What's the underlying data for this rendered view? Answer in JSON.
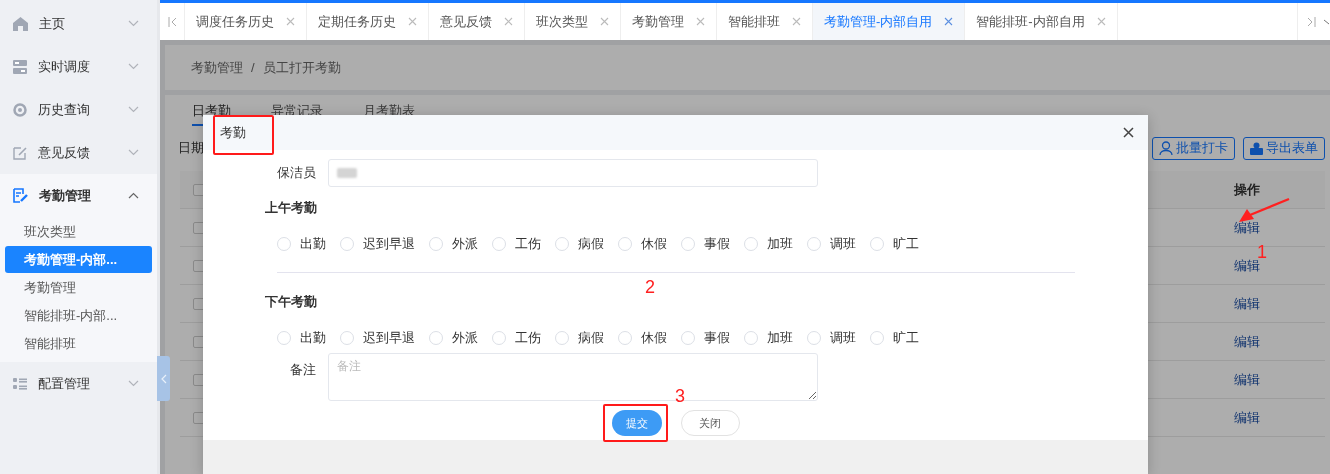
{
  "sidebar": {
    "items": [
      {
        "label": "主页",
        "kind": "home",
        "expanded": false
      },
      {
        "label": "实时调度",
        "kind": "grid",
        "expanded": false
      },
      {
        "label": "历史查询",
        "kind": "history",
        "expanded": false
      },
      {
        "label": "意见反馈",
        "kind": "edit",
        "expanded": false
      },
      {
        "label": "考勤管理",
        "kind": "attendance",
        "expanded": true,
        "children": [
          {
            "label": "班次类型",
            "selected": false
          },
          {
            "label": "考勤管理-内部...",
            "selected": true
          },
          {
            "label": "考勤管理",
            "selected": false
          },
          {
            "label": "智能排班-内部...",
            "selected": false
          },
          {
            "label": "智能排班",
            "selected": false
          }
        ]
      },
      {
        "label": "配置管理",
        "kind": "config",
        "expanded": false
      }
    ]
  },
  "tabs": [
    {
      "label": "调度任务历史",
      "selected": false
    },
    {
      "label": "定期任务历史",
      "selected": false
    },
    {
      "label": "意见反馈",
      "selected": false
    },
    {
      "label": "班次类型",
      "selected": false
    },
    {
      "label": "考勤管理",
      "selected": false
    },
    {
      "label": "智能排班",
      "selected": false
    },
    {
      "label": "考勤管理-内部自用",
      "selected": true
    },
    {
      "label": "智能排班-内部自用",
      "selected": false
    }
  ],
  "breadcrumb": {
    "items": [
      "考勤管理",
      "员工打开考勤"
    ],
    "separator": "/"
  },
  "page_tabs": [
    {
      "label": "日考勤",
      "selected": true
    },
    {
      "label": "异常记录",
      "selected": false
    },
    {
      "label": "月考勤表",
      "selected": false
    }
  ],
  "filter_label": "日期",
  "toolbar_buttons": [
    {
      "label": "批量打卡",
      "kind": "user"
    },
    {
      "label": "导出表单",
      "kind": "export"
    }
  ],
  "table": {
    "columns": [
      "操作"
    ],
    "header_checked": false,
    "rows": [
      {
        "checked": false,
        "action": "编辑"
      },
      {
        "checked": false,
        "action": "编辑"
      },
      {
        "checked": false,
        "action": "编辑"
      },
      {
        "checked": false,
        "action": "编辑"
      },
      {
        "checked": false,
        "action": "编辑"
      },
      {
        "checked": false,
        "action": "编辑"
      }
    ]
  },
  "dialog": {
    "title": "考勤",
    "cleaner_label": "保洁员",
    "sections": [
      {
        "title": "上午考勤",
        "options": [
          {
            "label": "出勤",
            "selected": false
          },
          {
            "label": "迟到早退",
            "selected": false
          },
          {
            "label": "外派",
            "selected": false
          },
          {
            "label": "工伤",
            "selected": false
          },
          {
            "label": "病假",
            "selected": false
          },
          {
            "label": "休假",
            "selected": false
          },
          {
            "label": "事假",
            "selected": false
          },
          {
            "label": "加班",
            "selected": false
          },
          {
            "label": "调班",
            "selected": false
          },
          {
            "label": "旷工",
            "selected": false
          }
        ]
      },
      {
        "title": "下午考勤",
        "options": [
          {
            "label": "出勤",
            "selected": false
          },
          {
            "label": "迟到早退",
            "selected": false
          },
          {
            "label": "外派",
            "selected": false
          },
          {
            "label": "工伤",
            "selected": false
          },
          {
            "label": "病假",
            "selected": false
          },
          {
            "label": "休假",
            "selected": false
          },
          {
            "label": "事假",
            "selected": false
          },
          {
            "label": "加班",
            "selected": false
          },
          {
            "label": "调班",
            "selected": false
          },
          {
            "label": "旷工",
            "selected": false
          }
        ]
      }
    ],
    "remark": {
      "label": "备注",
      "placeholder": "备注"
    },
    "buttons": [
      {
        "label": "提交",
        "kind": "primary"
      },
      {
        "label": "关闭",
        "kind": "default"
      }
    ]
  },
  "annotations": [
    {
      "text": "1"
    },
    {
      "text": "2"
    },
    {
      "text": "3"
    }
  ]
}
